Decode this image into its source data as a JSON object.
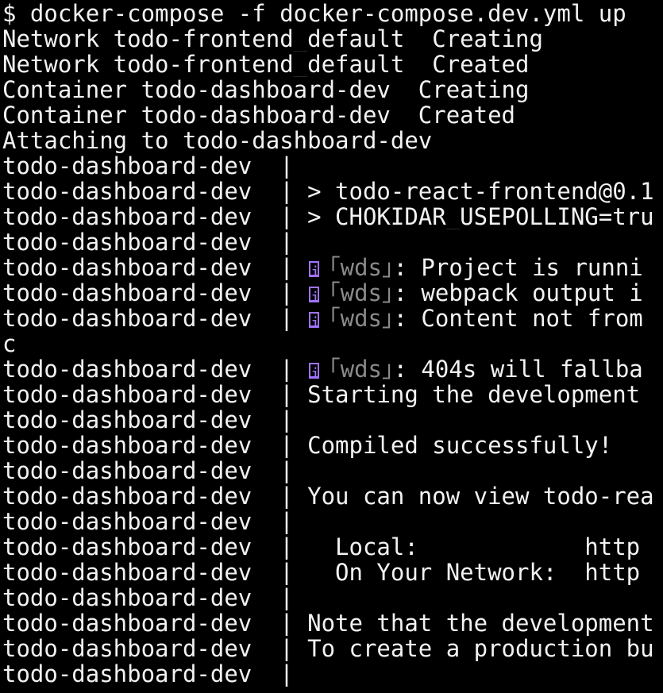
{
  "terminal": {
    "command": "$ docker-compose -f docker-compose.dev.yml up",
    "lines": [
      "Network todo-frontend_default  Creating",
      "Network todo-frontend_default  Created",
      "Container todo-dashboard-dev  Creating",
      "Container todo-dashboard-dev  Created",
      "Attaching to todo-dashboard-dev",
      "todo-dashboard-dev  |",
      "todo-dashboard-dev  | > todo-react-frontend@0.1",
      "todo-dashboard-dev  | > CHOKIDAR_USEPOLLING=tru",
      "todo-dashboard-dev  |"
    ],
    "wds_prefix": "todo-dashboard-dev  | ",
    "wds_icon": "i",
    "wds_tag": "｢wds｣",
    "wds_lines": [
      ": Project is runni",
      ": webpack output i",
      ": Content not from"
    ],
    "stray_char": "c",
    "wds_line_404": ": 404s will fallba",
    "tail_lines": [
      "todo-dashboard-dev  | Starting the development",
      "todo-dashboard-dev  |",
      "todo-dashboard-dev  | Compiled successfully!",
      "todo-dashboard-dev  |",
      "todo-dashboard-dev  | You can now view todo-rea",
      "todo-dashboard-dev  |",
      "todo-dashboard-dev  |   Local:            http",
      "todo-dashboard-dev  |   On Your Network:  http",
      "todo-dashboard-dev  |",
      "todo-dashboard-dev  | Note that the development",
      "todo-dashboard-dev  | To create a production bu",
      "todo-dashboard-dev  |"
    ],
    "colors": {
      "background": "#000000",
      "text": "#f2f2f2",
      "wds_icon": "#9f73ff",
      "wds_tag": "#8a8a8a"
    }
  }
}
